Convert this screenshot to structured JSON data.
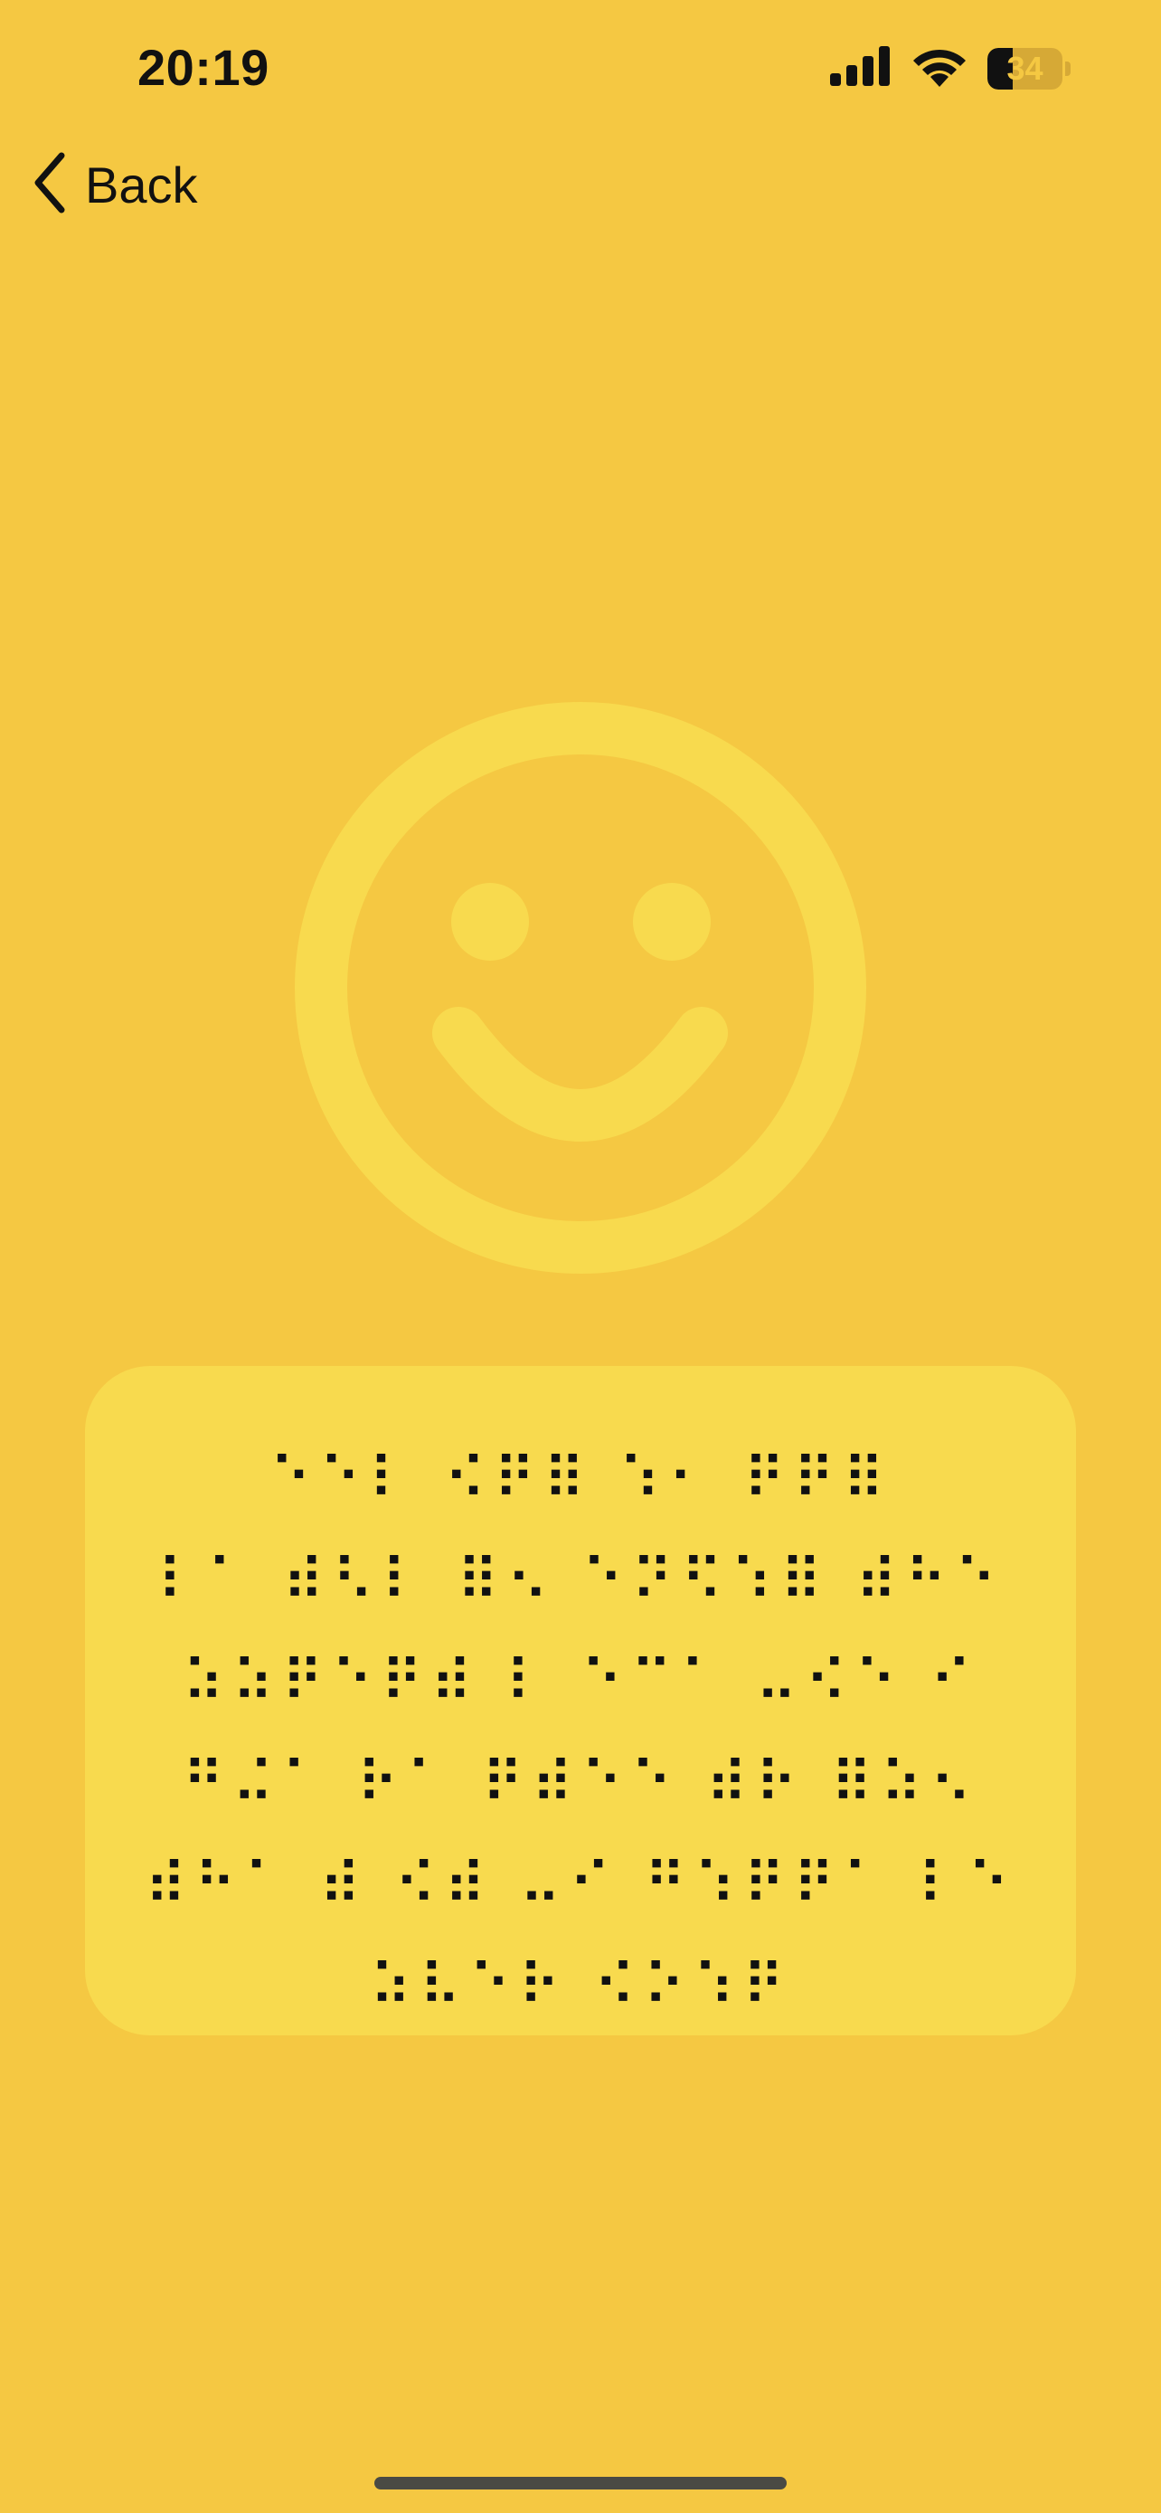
{
  "status_bar": {
    "time": "20:19",
    "battery_level": "34",
    "battery_fraction": 0.34,
    "icons": [
      "cellular-signal-icon",
      "wifi-icon",
      "battery-icon"
    ]
  },
  "nav": {
    "back_label": "Back",
    "back_icon": "chevron-left-icon"
  },
  "illustration": {
    "icon": "smiley-face-icon",
    "color": "#F8DA4E"
  },
  "braille_card": {
    "lines": [
      "⠑⠑⠇ ⠪⠟⠿ ⠱⠂ ⠟⠟⠿",
      "⠇⠁ ⠾⠣⠇ ⠿⠢ ⠑⠝⠫⠱⠿ ⠾⠓⠑",
      "⠵⠵⠟⠑⠟⠾ ⠇ ⠑⠉⠁ ⠤⠪⠑ ⠊",
      "⠛⠬⠁ ⠗⠁ ⠟⠾⠑⠑ ⠾⠗ ⠿⠵⠢",
      "⠾⠓⠁ ⠾ ⠪⠾ ⠤⠊ ⠛⠱⠟⠟⠁ ⠇⠑",
      "⠵⠧⠑⠗ ⠪⠕⠱⠟"
    ]
  },
  "colors": {
    "background": "#F5C842",
    "card": "#F8DA4E",
    "text": "#111111"
  }
}
